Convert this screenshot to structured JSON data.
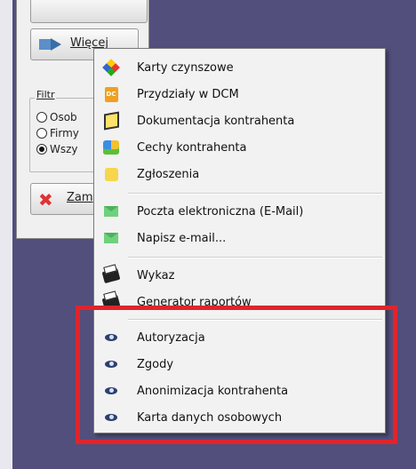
{
  "window": {
    "more_button_label": "Więcej",
    "filter_label": "Filtr",
    "filter_options": [
      "Osob",
      "Firmy",
      "Wszy"
    ],
    "close_button_label": "Zam"
  },
  "menu": {
    "items": [
      {
        "label": "Karty czynszowe",
        "icon": "multicolor-diamond-icon"
      },
      {
        "label": "Przydziały w DCM",
        "icon": "dcm-document-icon"
      },
      {
        "label": "Dokumentacja kontrahenta",
        "icon": "box-icon"
      },
      {
        "label": "Cechy kontrahenta",
        "icon": "puzzle-icon"
      },
      {
        "label": "Zgłoszenia",
        "icon": "note-icon"
      },
      {
        "label": "Poczta elektroniczna (E-Mail)",
        "icon": "mail-icon"
      },
      {
        "label": "Napisz e-mail...",
        "icon": "mail-icon"
      },
      {
        "label": "Wykaz",
        "icon": "printer-icon"
      },
      {
        "label": "Generator raportów",
        "icon": "printer-icon"
      },
      {
        "label": "Autoryzacja",
        "icon": "eye-icon"
      },
      {
        "label": "Zgody",
        "icon": "eye-icon"
      },
      {
        "label": "Anonimizacja kontrahenta",
        "icon": "eye-icon"
      },
      {
        "label": "Karta danych osobowych",
        "icon": "eye-icon"
      }
    ]
  },
  "highlight_color": "#e0242b"
}
